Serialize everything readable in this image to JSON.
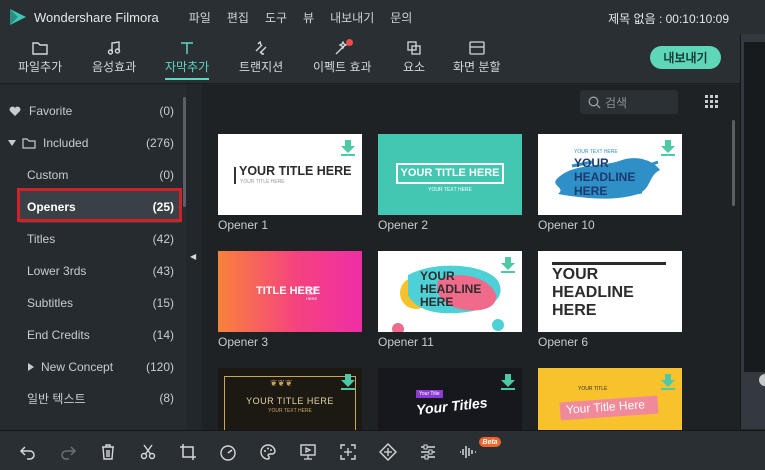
{
  "app": {
    "name": "Wondershare Filmora",
    "title_info": "제목 없음 : 00:10:10:09"
  },
  "menu": [
    "파일",
    "편집",
    "도구",
    "뷰",
    "내보내기",
    "문의"
  ],
  "toolbar": {
    "tools": [
      {
        "label": "파일추가",
        "icon": "folder-icon"
      },
      {
        "label": "음성효과",
        "icon": "music-note-icon"
      },
      {
        "label": "자막추가",
        "icon": "text-t-icon"
      },
      {
        "label": "트랜지션",
        "icon": "transition-icon"
      },
      {
        "label": "이펙트 효과",
        "icon": "magic-wand-icon"
      },
      {
        "label": "요소",
        "icon": "element-icon"
      },
      {
        "label": "화면 분할",
        "icon": "split-screen-icon"
      }
    ],
    "export_label": "내보내기",
    "accent": "#5ed6c4"
  },
  "sidebar": {
    "items": [
      {
        "label": "Favorite",
        "count": "(0)"
      },
      {
        "label": "Included",
        "count": "(276)"
      },
      {
        "label": "Custom",
        "count": "(0)"
      },
      {
        "label": "Openers",
        "count": "(25)"
      },
      {
        "label": "Titles",
        "count": "(42)"
      },
      {
        "label": "Lower 3rds",
        "count": "(43)"
      },
      {
        "label": "Subtitles",
        "count": "(15)"
      },
      {
        "label": "End Credits",
        "count": "(14)"
      },
      {
        "label": "New Concept",
        "count": "(120)"
      },
      {
        "label": "일반 텍스트",
        "count": "(8)"
      }
    ]
  },
  "search": {
    "placeholder": "검색"
  },
  "thumbnails": [
    {
      "name": "Opener 1",
      "text": "YOUR TITLE HERE",
      "sub": "YOUR TITLE HERE"
    },
    {
      "name": "Opener 2",
      "text": "YOUR TITLE HERE",
      "sub": "YOUR TEXT HERE"
    },
    {
      "name": "Opener 10",
      "text_top": "YOUR TEXT HERE",
      "lines": [
        "YOUR",
        "HEADLINE",
        "HERE"
      ]
    },
    {
      "name": "Opener 3",
      "text": "TITLE HERE",
      "sub": "YOUR TEXT HERE"
    },
    {
      "name": "Opener 11",
      "lines": [
        "YOUR",
        "HEADLINE",
        "HERE"
      ]
    },
    {
      "name": "Opener 6",
      "lines": [
        "YOUR",
        "HEADLINE",
        "HERE"
      ]
    },
    {
      "text": "YOUR TITLE HERE",
      "sub": "YOUR TEXT HERE"
    },
    {
      "tag": "Your Title",
      "text": "Your Titles"
    },
    {
      "tag": "YOUR TITLE",
      "text": "Your Title Here"
    }
  ],
  "bottom": {
    "beta_label": "Beta"
  }
}
